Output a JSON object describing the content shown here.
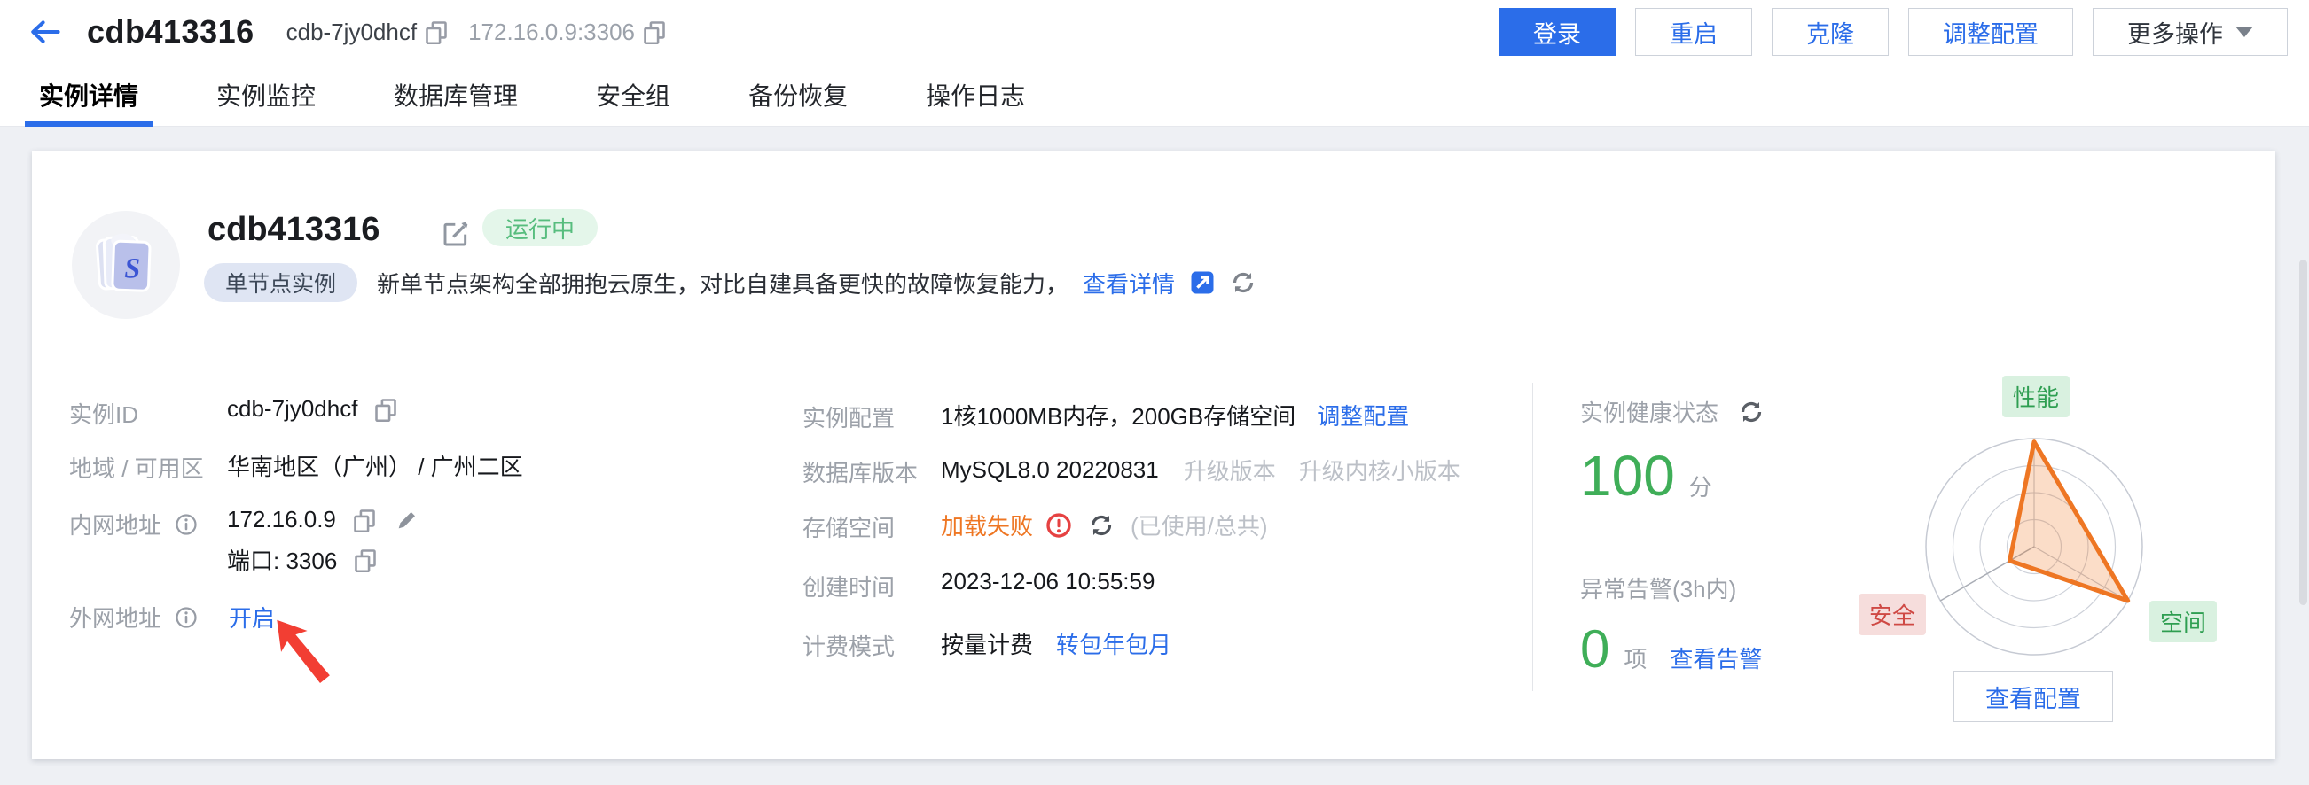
{
  "header": {
    "title": "cdb413316",
    "instance_id": "cdb-7jy0dhcf",
    "endpoint": "172.16.0.9:3306",
    "actions": {
      "login": "登录",
      "restart": "重启",
      "clone": "克隆",
      "resize": "调整配置",
      "more": "更多操作"
    }
  },
  "tabs": {
    "items": [
      {
        "label": "实例详情"
      },
      {
        "label": "实例监控"
      },
      {
        "label": "数据库管理"
      },
      {
        "label": "安全组"
      },
      {
        "label": "备份恢复"
      },
      {
        "label": "操作日志"
      }
    ],
    "active": "实例详情"
  },
  "instance": {
    "name": "cdb413316",
    "status": "运行中",
    "type_badge": "单节点实例",
    "description": "新单节点架构全部拥抱云原生，对比自建具备更快的故障恢复能力，",
    "detail_link": "查看详情"
  },
  "details": {
    "instance_id_label": "实例ID",
    "instance_id": "cdb-7jy0dhcf",
    "region_label": "地域 / 可用区",
    "region": "华南地区（广州） / 广州二区",
    "private_label": "内网地址",
    "private_ip": "172.16.0.9",
    "port_line": "端口: 3306",
    "public_label": "外网地址",
    "public_action": "开启",
    "config_label": "实例配置",
    "config_value": "1核1000MB内存，200GB存储空间",
    "config_link": "调整配置",
    "version_label": "数据库版本",
    "version_value": "MySQL8.0 20220831",
    "upgrade_version": "升级版本",
    "upgrade_kernel": "升级内核小版本",
    "storage_label": "存储空间",
    "storage_error": "加载失败",
    "storage_hint": "(已使用/总共)",
    "created_label": "创建时间",
    "created_value": "2023-12-06 10:55:59",
    "billing_label": "计费模式",
    "billing_value": "按量计费",
    "billing_link": "转包年包月"
  },
  "health": {
    "title": "实例健康状态",
    "score": "100",
    "score_unit": "分",
    "alarm_label": "异常告警(3h内)",
    "alarm_count": "0",
    "alarm_unit": "项",
    "alarm_link": "查看告警",
    "config_button": "查看配置"
  },
  "chart_data": {
    "type": "radar",
    "categories": [
      "性能",
      "空间",
      "安全"
    ],
    "values": [
      97,
      100,
      26
    ],
    "range": [
      0,
      100
    ],
    "rings": 4,
    "angles_deg": [
      -90,
      30,
      150
    ],
    "series_color": "#ee7623",
    "fill_opacity": 0.25,
    "label_styles": [
      "green",
      "green",
      "red"
    ],
    "legend_position": "around"
  },
  "colors": {
    "primary_blue": "#2b6de9",
    "success_green": "#3fae58",
    "warn_orange": "#ee7623",
    "error_red": "#e64242"
  }
}
